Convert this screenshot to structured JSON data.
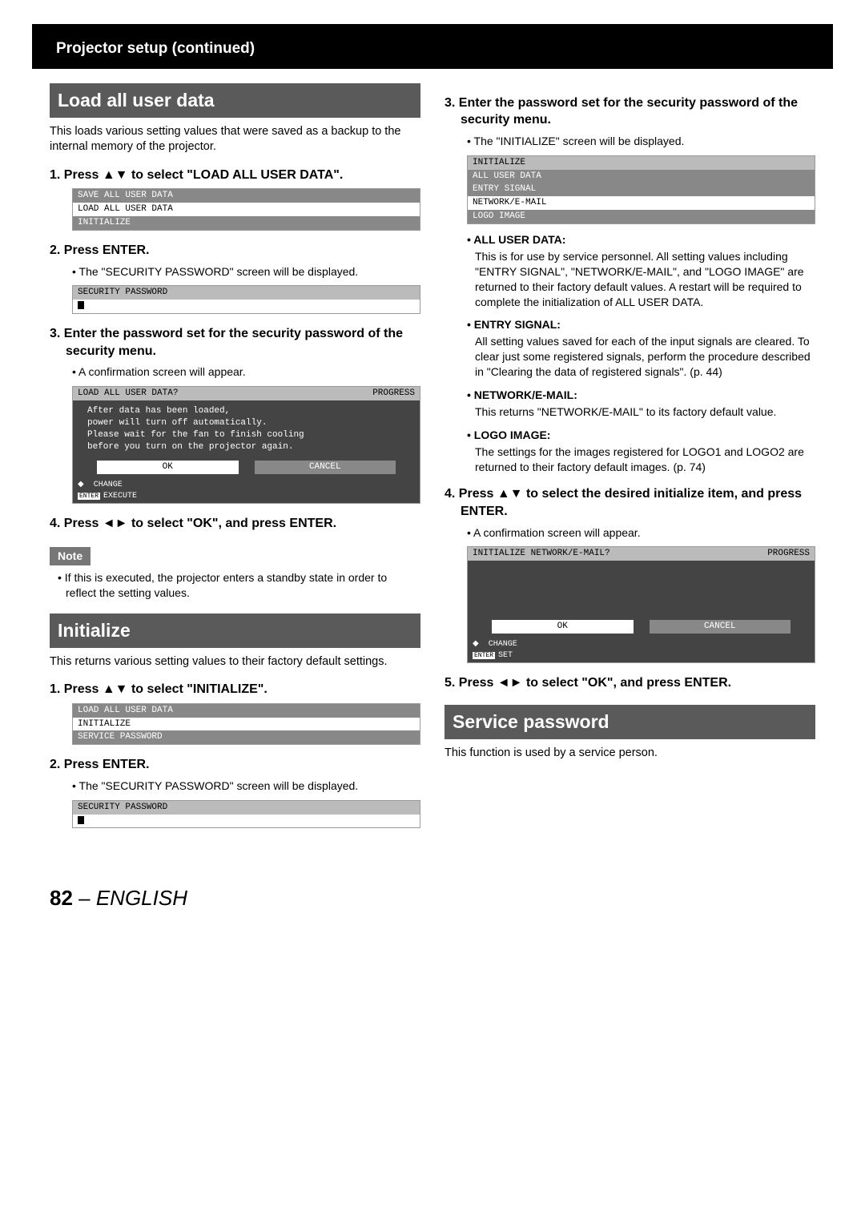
{
  "header": {
    "title": "Projector setup (continued)"
  },
  "left": {
    "sec1": {
      "heading": "Load all user data",
      "intro": "This loads various setting values that were saved as a backup to the internal memory of the projector.",
      "step1": "1. Press ▲▼ to select \"LOAD ALL USER DATA\".",
      "osd1": {
        "r1": "SAVE ALL USER DATA",
        "r2": "LOAD ALL USER DATA",
        "r3": "INITIALIZE"
      },
      "step2": "2. Press ENTER.",
      "sub2": "The \"SECURITY PASSWORD\" screen will be displayed.",
      "osd2": {
        "hdr": "SECURITY PASSWORD"
      },
      "step3": "3. Enter the password set for the security password of the security menu.",
      "sub3": "A confirmation screen will appear.",
      "osd3": {
        "hdr_l": "LOAD ALL USER DATA?",
        "hdr_r": "PROGRESS",
        "l1": "After data has been loaded,",
        "l2": "power will turn off automatically.",
        "l3": "Please wait for the fan to finish cooling",
        "l4": "before you turn on the projector again.",
        "ok": "OK",
        "cancel": "CANCEL",
        "ft1": "CHANGE",
        "ft2": "EXECUTE",
        "enter": "ENTER"
      },
      "step4": "4. Press ◄► to select \"OK\", and press ENTER.",
      "note_label": "Note",
      "note": "If this is executed, the projector enters a standby state in order to reflect the setting values."
    },
    "sec2": {
      "heading": "Initialize",
      "intro": "This returns various setting values to their factory default settings.",
      "step1": "1. Press ▲▼ to select \"INITIALIZE\".",
      "osd1": {
        "r1": "LOAD ALL USER DATA",
        "r2": "INITIALIZE",
        "r3": "SERVICE PASSWORD"
      },
      "step2": "2. Press ENTER.",
      "sub2": "The \"SECURITY PASSWORD\" screen will be displayed.",
      "osd2": {
        "hdr": "SECURITY PASSWORD"
      }
    }
  },
  "right": {
    "step3": "3. Enter the password set for the security password of the security menu.",
    "sub3": "The \"INITIALIZE\" screen will be displayed.",
    "osd3": {
      "r1": "INITIALIZE",
      "r2": "ALL USER DATA",
      "r3": "ENTRY SIGNAL",
      "r4": "NETWORK/E-MAIL",
      "r5": "LOGO IMAGE"
    },
    "defs": {
      "t1": "ALL USER DATA:",
      "d1": "This is for use by service personnel. All setting values including \"ENTRY SIGNAL\", \"NETWORK/E-MAIL\", and \"LOGO IMAGE\" are returned to their factory default values. A restart will be required to complete the initialization of ALL USER DATA.",
      "t2": "ENTRY SIGNAL:",
      "d2": "All setting values saved for each of the input signals are cleared. To clear just some registered signals, perform the procedure described in \"Clearing the data of registered signals\". (p. 44)",
      "t3": "NETWORK/E-MAIL:",
      "d3": "This returns \"NETWORK/E-MAIL\" to its factory default value.",
      "t4": "LOGO IMAGE:",
      "d4": "The settings for the images registered for LOGO1 and LOGO2 are returned to their factory default images. (p. 74)"
    },
    "step4": "4. Press ▲▼ to select the desired initialize item, and press ENTER.",
    "sub4": "A confirmation screen will appear.",
    "osd4": {
      "hdr_l": "INITIALIZE NETWORK/E-MAIL?",
      "hdr_r": "PROGRESS",
      "ok": "OK",
      "cancel": "CANCEL",
      "ft1": "CHANGE",
      "ft2": "SET",
      "enter": "ENTER"
    },
    "step5": "5. Press ◄► to select \"OK\", and press ENTER.",
    "sec3": {
      "heading": "Service password",
      "intro": "This function is used by a service person."
    }
  },
  "footer": {
    "page": "82",
    "sep": " – ",
    "lang": "ENGLISH"
  }
}
